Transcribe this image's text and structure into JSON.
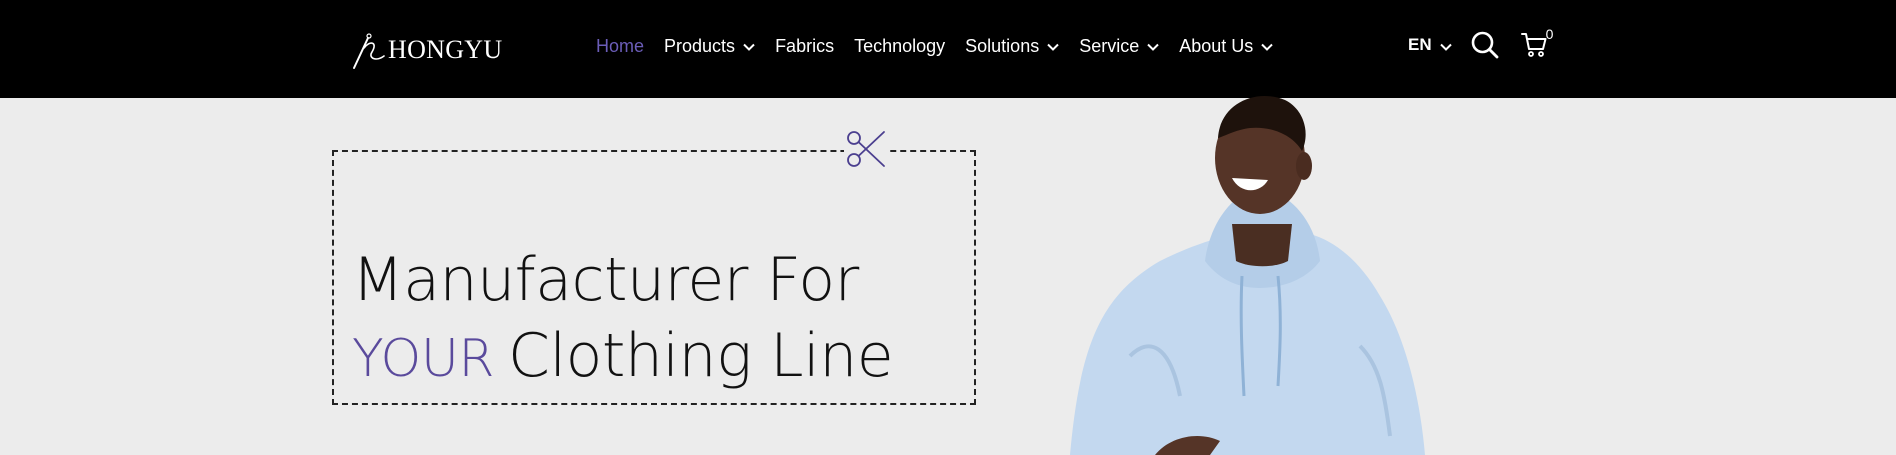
{
  "brand": {
    "name": "HONGYU",
    "logo_icon": "needle-thread-icon"
  },
  "nav": {
    "items": [
      {
        "label": "Home",
        "active": true,
        "dropdown": false
      },
      {
        "label": "Products",
        "active": false,
        "dropdown": true
      },
      {
        "label": "Fabrics",
        "active": false,
        "dropdown": false
      },
      {
        "label": "Technology",
        "active": false,
        "dropdown": false
      },
      {
        "label": "Solutions",
        "active": false,
        "dropdown": true
      },
      {
        "label": "Service",
        "active": false,
        "dropdown": true
      },
      {
        "label": "About Us",
        "active": false,
        "dropdown": true
      }
    ]
  },
  "utils": {
    "language": "EN",
    "cart_count": "0"
  },
  "hero": {
    "line1": "Manufacturer For",
    "accent": "YOUR",
    "line2": "Clothing Line"
  },
  "colors": {
    "header_bg": "#000000",
    "accent": "#5a4a9c",
    "nav_active": "#6b5db8",
    "page_bg": "#ececec"
  }
}
